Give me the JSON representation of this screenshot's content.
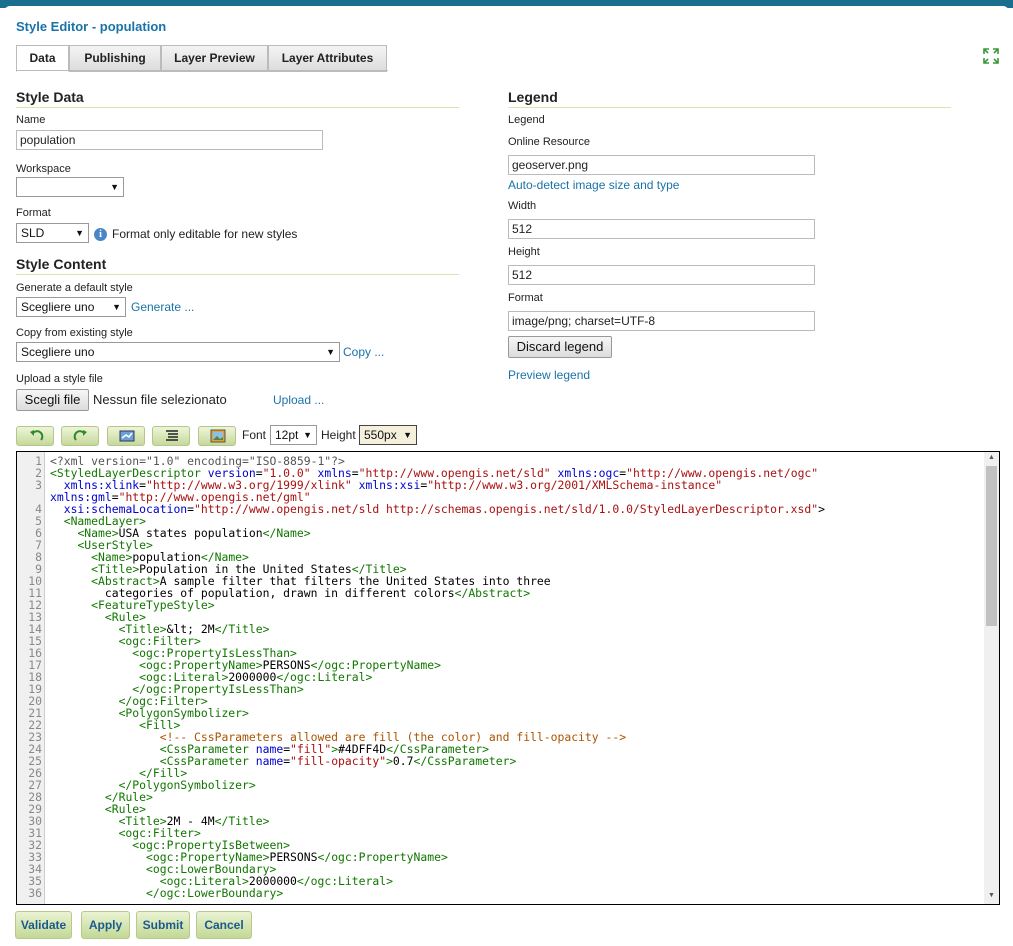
{
  "window": {
    "title": "Style Editor - population"
  },
  "tabs": [
    {
      "label": "Data",
      "active": true
    },
    {
      "label": "Publishing",
      "active": false
    },
    {
      "label": "Layer Preview",
      "active": false
    },
    {
      "label": "Layer Attributes",
      "active": false
    }
  ],
  "style_data": {
    "heading": "Style Data",
    "name_label": "Name",
    "name_value": "population",
    "workspace_label": "Workspace",
    "workspace_value": "",
    "format_label": "Format",
    "format_value": "SLD",
    "format_note": "Format only editable for new styles"
  },
  "style_content": {
    "heading": "Style Content",
    "generate_label": "Generate a default style",
    "generate_value": "Scegliere uno",
    "generate_link": "Generate ...",
    "copy_label": "Copy from existing style",
    "copy_value": "Scegliere uno",
    "copy_link": "Copy ...",
    "upload_label": "Upload a style file",
    "choose_file_button": "Scegli file",
    "no_file_text": "Nessun file selezionato",
    "upload_link": "Upload ..."
  },
  "legend": {
    "heading": "Legend",
    "legend_label": "Legend",
    "online_resource_label": "Online Resource",
    "online_resource_value": "geoserver.png",
    "auto_detect_link": "Auto-detect image size and type",
    "width_label": "Width",
    "width_value": "512",
    "height_label": "Height",
    "height_value": "512",
    "format_label": "Format",
    "format_value": "image/png; charset=UTF-8",
    "discard_button": "Discard legend",
    "preview_link": "Preview legend"
  },
  "toolbar": {
    "icons": [
      "undo-icon",
      "redo-icon",
      "go-to-line-icon",
      "reformat-icon",
      "image-icon"
    ],
    "font_label": "Font",
    "font_value": "12pt",
    "height_label": "Height",
    "height_value": "550px"
  },
  "editor": {
    "lines": [
      {
        "n": "1",
        "t": "<?xml version=\"1.0\" encoding=\"ISO-8859-1\"?>"
      },
      {
        "n": "2",
        "t": "<StyledLayerDescriptor version=\"1.0.0\" xmlns=\"http://www.opengis.net/sld\" xmlns:ogc=\"http://www.opengis.net/ogc\""
      },
      {
        "n": "3",
        "t": "  xmlns:xlink=\"http://www.w3.org/1999/xlink\" xmlns:xsi=\"http://www.w3.org/2001/XMLSchema-instance\""
      },
      {
        "n": "",
        "t": "xmlns:gml=\"http://www.opengis.net/gml\""
      },
      {
        "n": "4",
        "t": "  xsi:schemaLocation=\"http://www.opengis.net/sld http://schemas.opengis.net/sld/1.0.0/StyledLayerDescriptor.xsd\">"
      },
      {
        "n": "5",
        "t": "  <NamedLayer>"
      },
      {
        "n": "6",
        "t": "    <Name>USA states population</Name>"
      },
      {
        "n": "7",
        "t": "    <UserStyle>"
      },
      {
        "n": "8",
        "t": "      <Name>population</Name>"
      },
      {
        "n": "9",
        "t": "      <Title>Population in the United States</Title>"
      },
      {
        "n": "10",
        "t": "      <Abstract>A sample filter that filters the United States into three"
      },
      {
        "n": "11",
        "t": "        categories of population, drawn in different colors</Abstract>"
      },
      {
        "n": "12",
        "t": "      <FeatureTypeStyle>"
      },
      {
        "n": "13",
        "t": "        <Rule>"
      },
      {
        "n": "14",
        "t": "          <Title>&lt; 2M</Title>"
      },
      {
        "n": "15",
        "t": "          <ogc:Filter>"
      },
      {
        "n": "16",
        "t": "            <ogc:PropertyIsLessThan>"
      },
      {
        "n": "17",
        "t": "             <ogc:PropertyName>PERSONS</ogc:PropertyName>"
      },
      {
        "n": "18",
        "t": "             <ogc:Literal>2000000</ogc:Literal>"
      },
      {
        "n": "19",
        "t": "            </ogc:PropertyIsLessThan>"
      },
      {
        "n": "20",
        "t": "          </ogc:Filter>"
      },
      {
        "n": "21",
        "t": "          <PolygonSymbolizer>"
      },
      {
        "n": "22",
        "t": "             <Fill>"
      },
      {
        "n": "23",
        "t": "                <!-- CssParameters allowed are fill (the color) and fill-opacity -->"
      },
      {
        "n": "24",
        "t": "                <CssParameter name=\"fill\">#4DFF4D</CssParameter>"
      },
      {
        "n": "25",
        "t": "                <CssParameter name=\"fill-opacity\">0.7</CssParameter>"
      },
      {
        "n": "26",
        "t": "             </Fill>"
      },
      {
        "n": "27",
        "t": "          </PolygonSymbolizer>"
      },
      {
        "n": "28",
        "t": "        </Rule>"
      },
      {
        "n": "29",
        "t": "        <Rule>"
      },
      {
        "n": "30",
        "t": "          <Title>2M - 4M</Title>"
      },
      {
        "n": "31",
        "t": "          <ogc:Filter>"
      },
      {
        "n": "32",
        "t": "            <ogc:PropertyIsBetween>"
      },
      {
        "n": "33",
        "t": "              <ogc:PropertyName>PERSONS</ogc:PropertyName>"
      },
      {
        "n": "34",
        "t": "              <ogc:LowerBoundary>"
      },
      {
        "n": "35",
        "t": "                <ogc:Literal>2000000</ogc:Literal>"
      },
      {
        "n": "36",
        "t": "              </ogc:LowerBoundary>"
      }
    ]
  },
  "actions": {
    "validate": "Validate",
    "apply": "Apply",
    "submit": "Submit",
    "cancel": "Cancel"
  },
  "colors": {
    "title": "#1a73a8",
    "link": "#1a73a8",
    "heading_rule": "#e2dfb0",
    "xml_tag": "#117700",
    "xml_attribute": "#0000cc",
    "xml_string": "#aa1111",
    "xml_comment": "#aa5500"
  }
}
